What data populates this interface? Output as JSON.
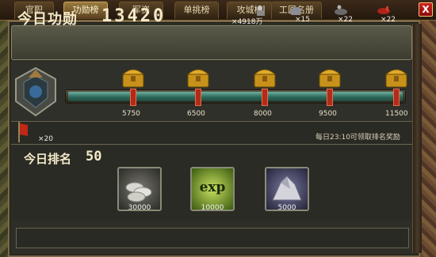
{
  "tabs": [
    {
      "label": "官职",
      "active": false
    },
    {
      "label": "功勋榜",
      "active": true
    },
    {
      "label": "军资",
      "active": false
    },
    {
      "label": "单挑榜",
      "active": false
    },
    {
      "label": "攻城榜",
      "active": false
    },
    {
      "label": "工匠名册",
      "active": false
    }
  ],
  "close_label": "X",
  "header": {
    "merit_label": "今日功勋",
    "merit_value": "13420",
    "resources": [
      {
        "icon": "soldier-icon",
        "count": "×4918万"
      },
      {
        "icon": "iron-ore-icon",
        "count": "×15"
      },
      {
        "icon": "cavalry-icon",
        "count": "×22"
      },
      {
        "icon": "red-horse-icon",
        "count": "×22"
      }
    ]
  },
  "progress": {
    "current": 13420,
    "max": 11500,
    "fraction": 1.0,
    "milestones": [
      "5750",
      "6500",
      "8000",
      "9500",
      "11500"
    ]
  },
  "reward_info": {
    "banner_count": "×20",
    "claim_note": "每日23:10可领取排名奖励"
  },
  "rank": {
    "label": "今日排名",
    "value": "50",
    "rewards": [
      {
        "icon": "silver-coins-icon",
        "amount": "30000"
      },
      {
        "icon": "exp-icon",
        "text": "exp",
        "amount": "10000"
      },
      {
        "icon": "stone-icon",
        "amount": "5000"
      }
    ]
  },
  "colors": {
    "teal_fill": "#2f6a5c",
    "active_tab": "#9a7a3e",
    "close_red": "#d02020"
  }
}
